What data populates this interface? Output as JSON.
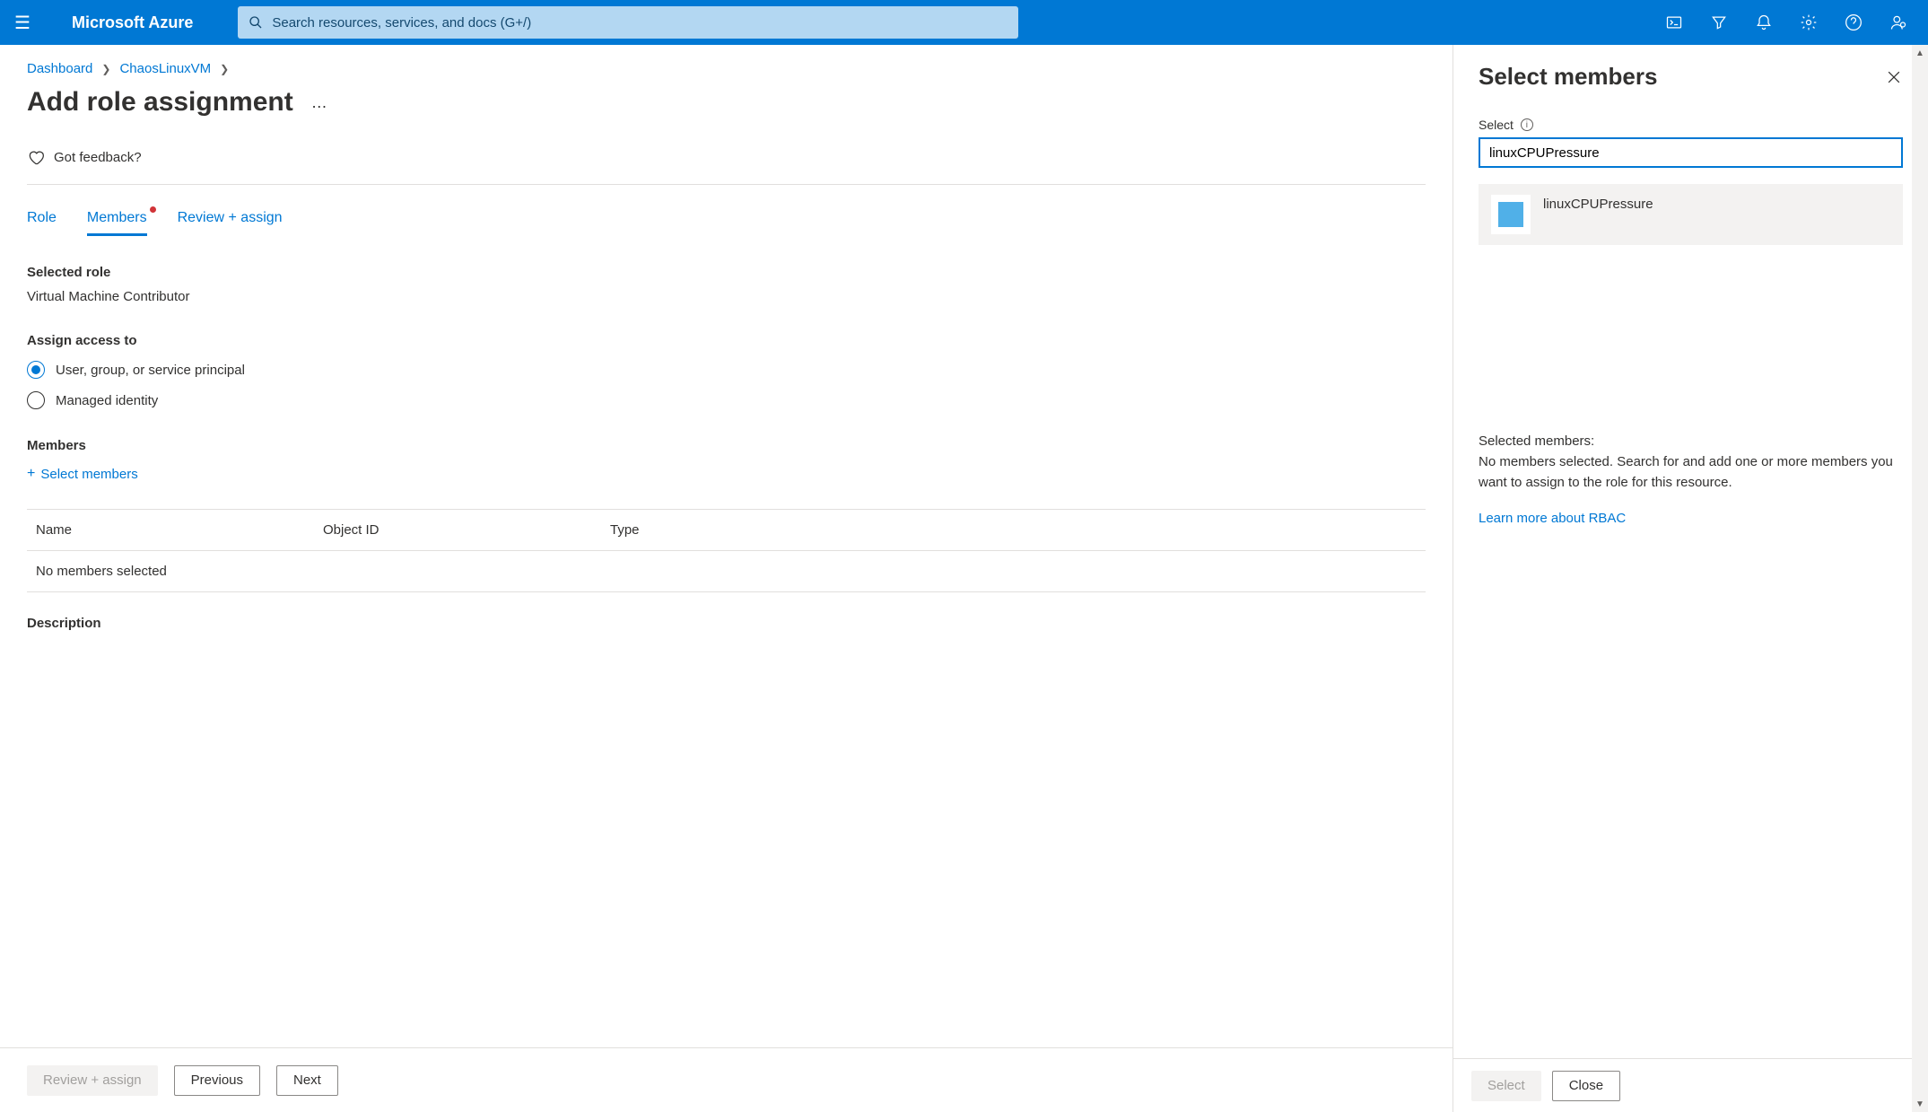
{
  "topbar": {
    "brand": "Microsoft Azure",
    "search_placeholder": "Search resources, services, and docs (G+/)"
  },
  "breadcrumb": {
    "items": [
      "Dashboard",
      "ChaosLinuxVM"
    ]
  },
  "page": {
    "title": "Add role assignment",
    "feedback": "Got feedback?"
  },
  "tabs": {
    "role": "Role",
    "members": "Members",
    "review": "Review + assign"
  },
  "selected_role": {
    "label": "Selected role",
    "value": "Virtual Machine Contributor"
  },
  "assign_access": {
    "label": "Assign access to",
    "options": [
      {
        "label": "User, group, or service principal",
        "checked": true
      },
      {
        "label": "Managed identity",
        "checked": false
      }
    ]
  },
  "members": {
    "label": "Members",
    "add_link": "Select members",
    "columns": {
      "name": "Name",
      "objid": "Object ID",
      "type": "Type"
    },
    "empty": "No members selected"
  },
  "description": {
    "label": "Description"
  },
  "footer": {
    "review": "Review + assign",
    "previous": "Previous",
    "next": "Next"
  },
  "panel": {
    "title": "Select members",
    "select_label": "Select",
    "search_value": "linuxCPUPressure",
    "result": {
      "name": "linuxCPUPressure"
    },
    "selected_label": "Selected members:",
    "selected_help": "No members selected. Search for and add one or more members you want to assign to the role for this resource.",
    "rbac_link": "Learn more about RBAC",
    "footer": {
      "select": "Select",
      "close": "Close"
    }
  }
}
